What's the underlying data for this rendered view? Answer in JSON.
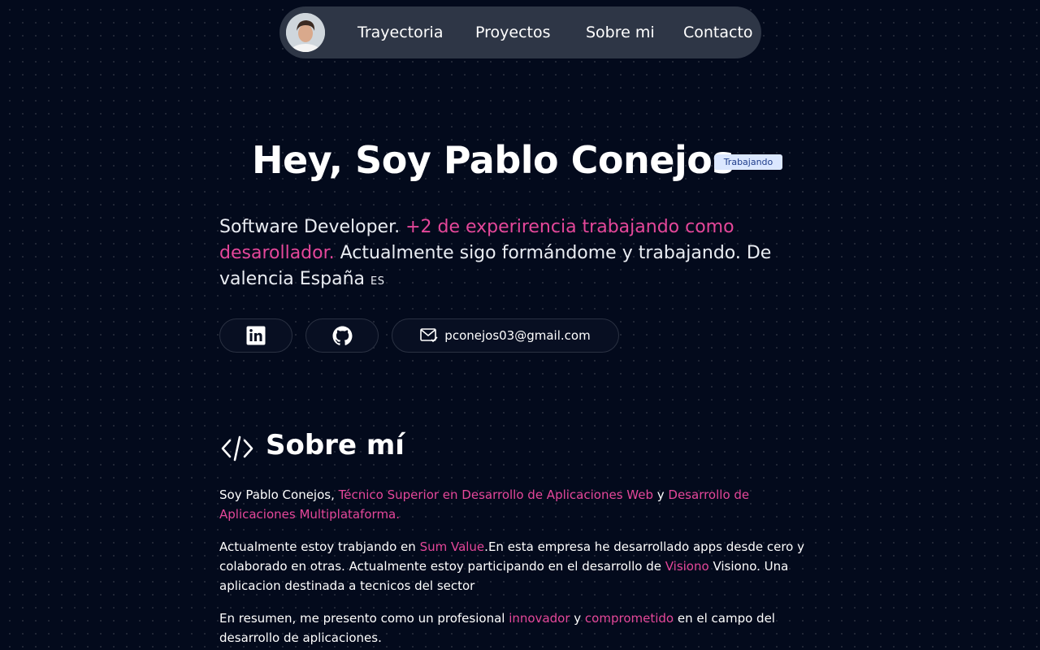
{
  "nav": {
    "avatar_alt": "Pablo Conejos",
    "links": [
      "Trayectoria",
      "Proyectos",
      "Sobre mi",
      "Contacto"
    ]
  },
  "hero": {
    "title": "Hey, Soy Pablo Conejos",
    "badge": "Trabajando",
    "intro": {
      "part1": "Software Developer. ",
      "highlight": "+2 de experirencia trabajando como desarollador.",
      "part2": " Actualmente sigo formándome y trabajando. De valencia España ",
      "flag": "ES"
    }
  },
  "social": {
    "linkedin_icon": "linkedin-icon",
    "github_icon": "github-icon",
    "email_icon": "mail-icon",
    "email": "pconejos03@gmail.com"
  },
  "about": {
    "title": "Sobre mí",
    "icon": "code-icon",
    "p1": {
      "a": "Soy Pablo Conejos, ",
      "h1": "Técnico Superior en Desarrollo de Aplicaciones Web",
      "b": " y ",
      "h2": "Desarrollo de Aplicaciones Multiplataforma."
    },
    "p2": {
      "a": "Actualmente estoy trabjando en ",
      "h1": "Sum Value",
      "b": ".En esta empresa he desarrollado apps desde cero y colaborado en otras. Actualmente estoy participando en el desarrollo de ",
      "h2": "Visiono",
      "c": " Visiono. Una aplicacion destinada a tecnicos del sector"
    },
    "p3": {
      "a": "En resumen, me presento como un profesional ",
      "h1": "innovador",
      "b": " y ",
      "h2": "comprometido",
      "c": " en el campo del desarrollo de aplicaciones."
    }
  },
  "colors": {
    "background": "#030a1c",
    "accent": "#e5479a",
    "nav_bg": "#2e3646",
    "badge_bg": "#dbe7ff",
    "badge_text": "#1f3d8a"
  }
}
